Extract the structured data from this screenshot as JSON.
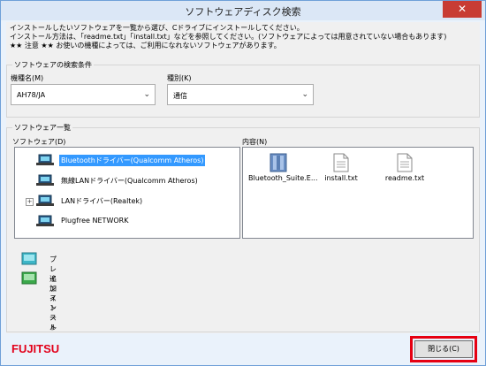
{
  "window": {
    "title": "ソフトウェアディスク検索",
    "close_glyph": "✕"
  },
  "intro": {
    "line1": "インストールしたいソフトウェアを一覧から選び、Cドライブにインストールしてください。",
    "line2": "インストール方法は、「readme.txt」「install.txt」などを参照してください。(ソフトウェアによっては用意されていない場合もあります)",
    "line3": "★★ 注意 ★★ お使いの機種によっては、ご利用になれないソフトウェアがあります。"
  },
  "search_conditions": {
    "legend": "ソフトウェアの検索条件",
    "model_label": "機種名(M)",
    "model_value": "AH78/JA",
    "type_label": "種別(K)",
    "type_value": "通信"
  },
  "software_list": {
    "legend": "ソフトウェア一覧",
    "software_label": "ソフトウェア(D)",
    "contents_label": "内容(N)",
    "items": [
      {
        "label": "Bluetoothドライバー(Qualcomm Atheros)",
        "selected": true,
        "expandable": false
      },
      {
        "label": "無線LANドライバー(Qualcomm Atheros)",
        "selected": false,
        "expandable": false
      },
      {
        "label": "LANドライバー(Realtek)",
        "selected": false,
        "expandable": true
      },
      {
        "label": "Plugfree NETWORK",
        "selected": false,
        "expandable": false
      }
    ],
    "files": [
      {
        "name": "Bluetooth_Suite.E...",
        "icon": "archive-icon"
      },
      {
        "name": "install.txt",
        "icon": "text-file-icon"
      },
      {
        "name": "readme.txt",
        "icon": "text-file-icon"
      }
    ]
  },
  "legend_items": {
    "preinstall": "プレインストール",
    "additional": "追加インストール"
  },
  "footer": {
    "logo": "FUJITSU",
    "close_button": "閉じる(C)"
  },
  "colors": {
    "accent": "#3399ff",
    "brand": "#e2001a",
    "highlight_box": "#e60012",
    "close_button": "#c83c34"
  }
}
